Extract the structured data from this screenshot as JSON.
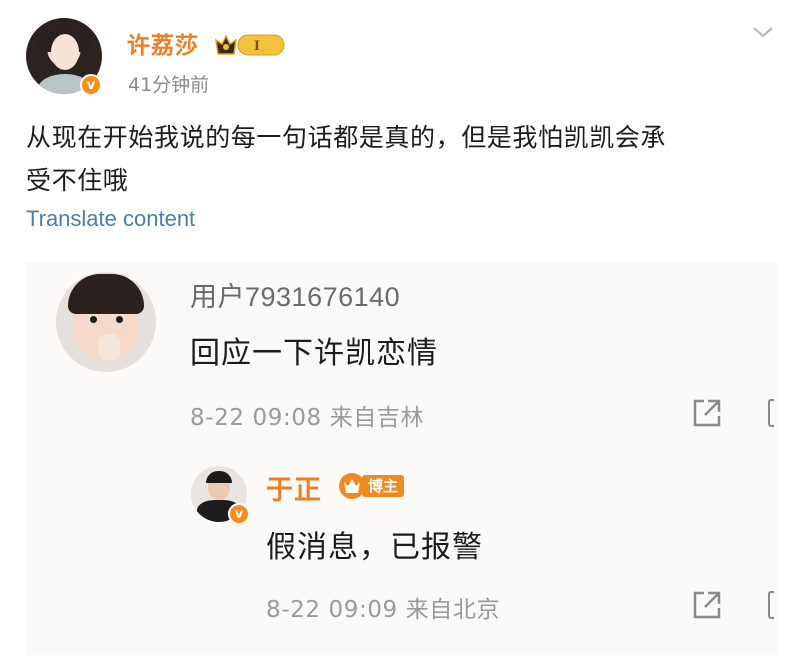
{
  "post": {
    "author": "许荔莎",
    "time_ago": "41分钟前",
    "vip_level": "I",
    "verified_mark": "v",
    "content_line1": "从现在开始我说的每一句话都是真的，但是我怕凯凯会承",
    "content_line2": "受不住哦",
    "translate_label": "Translate content",
    "icons": [
      "crown-vip-icon",
      "chevron-down-icon",
      "verified-icon"
    ]
  },
  "comment": {
    "user": "用户7931676140",
    "text": "回应一下许凯恋情",
    "meta": "8-22 09:08  来自吉林",
    "icons": [
      "share-icon"
    ]
  },
  "reply": {
    "user": "于正",
    "badge": "博主",
    "text": "假消息，已报警",
    "meta": "8-22 09:09  来自北京",
    "verified_mark": "v",
    "icons": [
      "crown-icon",
      "share-icon"
    ]
  },
  "colors": {
    "brand_orange": "#ef7d23",
    "link_blue": "#4d7ea8",
    "meta_gray": "#9a9a9a",
    "card_bg": "#fbfaf8"
  }
}
